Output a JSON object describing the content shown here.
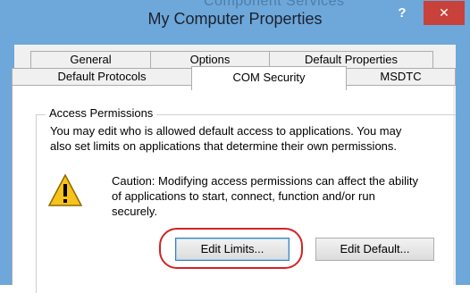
{
  "window": {
    "title": "My Computer Properties",
    "ghost_title": "Component Services",
    "help_label": "?",
    "close_label": "✕"
  },
  "tabs_row1": [
    {
      "label": "General"
    },
    {
      "label": "Options"
    },
    {
      "label": "Default Properties"
    }
  ],
  "tabs_row2": [
    {
      "label": "Default Protocols"
    },
    {
      "label": "COM Security",
      "active": true
    },
    {
      "label": "MSDTC"
    }
  ],
  "group": {
    "title": "Access Permissions",
    "description_line1": "You may edit who is allowed default access to applications. You may",
    "description_line2": "also set limits on applications that determine their own permissions.",
    "caution_line1": "Caution: Modifying access permissions can affect the ability",
    "caution_line2": "of applications to start, connect, function and/or run",
    "caution_line3": "securely."
  },
  "buttons": {
    "edit_limits": "Edit Limits...",
    "edit_default": "Edit Default..."
  },
  "colors": {
    "titlebar": "#6ea7d9",
    "close": "#c8413a",
    "highlight": "#d02424",
    "warning": "#f7c21b"
  },
  "icons": {
    "warning": "warning-icon"
  }
}
